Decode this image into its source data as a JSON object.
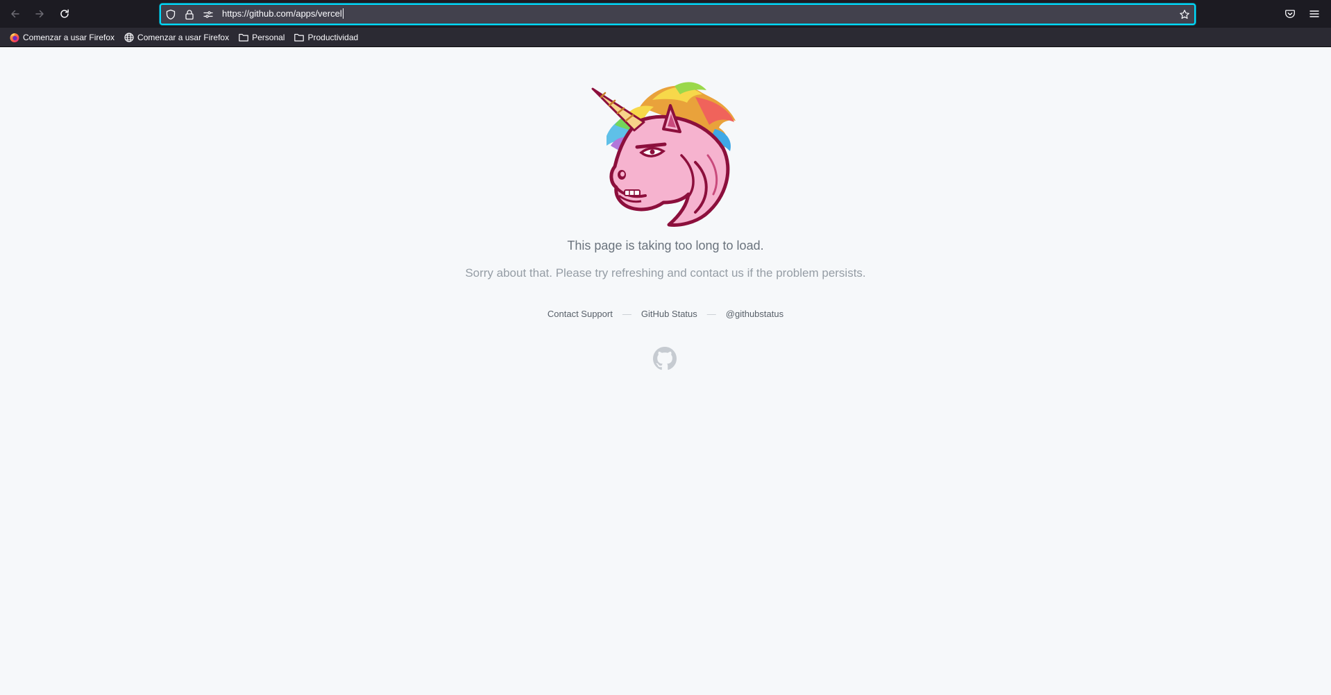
{
  "browser": {
    "url": "https://github.com/apps/vercel",
    "icons": {
      "back": "back-arrow-icon",
      "forward": "forward-arrow-icon",
      "reload": "reload-icon",
      "tracking": "shield-icon",
      "lock": "lock-icon",
      "permissions": "permissions-icon",
      "bookmark": "star-icon",
      "pocket": "pocket-icon",
      "menu": "hamburger-menu-icon"
    },
    "bookmarks": [
      {
        "label": "Comenzar a usar Firefox",
        "icon": "firefox-icon"
      },
      {
        "label": "Comenzar a usar Firefox",
        "icon": "globe-icon"
      },
      {
        "label": "Personal",
        "icon": "folder-icon"
      },
      {
        "label": "Productividad",
        "icon": "folder-icon"
      }
    ]
  },
  "page": {
    "title": "This page is taking too long to load.",
    "subtitle": "Sorry about that. Please try refreshing and contact us if the problem persists.",
    "links": [
      {
        "label": "Contact Support"
      },
      {
        "label": "GitHub Status"
      },
      {
        "label": "@githubstatus"
      }
    ],
    "separator": "—",
    "images": {
      "mascot": "angry-unicorn-illustration",
      "footer_logo": "github-octocat-icon"
    }
  },
  "colors": {
    "toolbar": "#1c1b22",
    "urlbar": "#42414d",
    "focus_ring": "#00ddff",
    "bookmarks_bar": "#2b2a33",
    "page_background": "#f6f8fa",
    "title_text": "#6a737d",
    "subtitle_text": "#959da5"
  }
}
